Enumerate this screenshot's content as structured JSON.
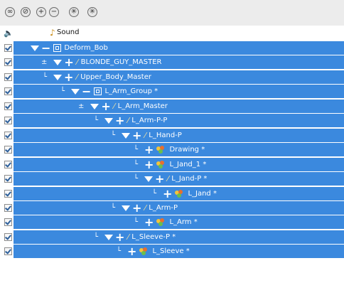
{
  "toolbar": {
    "buttons": [
      "show-all-icon",
      "hide-all-icon",
      "expand-all-icon",
      "collapse-all-icon",
      "add-layer-icon",
      "delete-layer-icon"
    ]
  },
  "sound_row": {
    "label": "Sound"
  },
  "layers": [
    {
      "name": "Deform_Bob",
      "type": "deform",
      "checked": true
    },
    {
      "name": "BLONDE_GUY_MASTER",
      "type": "peg",
      "checked": true
    },
    {
      "name": "Upper_Body_Master",
      "type": "peg",
      "checked": true
    },
    {
      "name": "L_Arm_Group *",
      "type": "deform",
      "checked": true
    },
    {
      "name": "L_Arm_Master",
      "type": "peg",
      "checked": true
    },
    {
      "name": "L_Arm-P-P",
      "type": "peg",
      "checked": true
    },
    {
      "name": "L_Hand-P",
      "type": "peg",
      "checked": true
    },
    {
      "name": "Drawing *",
      "type": "drawing",
      "checked": true
    },
    {
      "name": "L_Jand_1 *",
      "type": "drawing",
      "checked": true
    },
    {
      "name": "L_Jand-P *",
      "type": "peg",
      "checked": true
    },
    {
      "name": "L_Jand *",
      "type": "drawing",
      "checked": true
    },
    {
      "name": "L_Arm-P",
      "type": "peg",
      "checked": true
    },
    {
      "name": "L_Arm *",
      "type": "drawing",
      "checked": true
    },
    {
      "name": "L_Sleeve-P *",
      "type": "peg",
      "checked": true
    },
    {
      "name": "L_Sleeve *",
      "type": "drawing",
      "checked": true
    }
  ],
  "colors": {
    "selected_row": "#3b89de",
    "toolbar_bg": "#ececec"
  }
}
